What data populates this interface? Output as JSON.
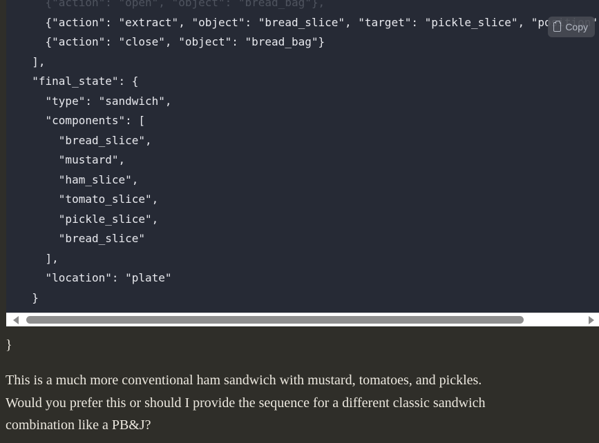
{
  "code": {
    "lines": [
      "    {\"action\": \"open\", \"object\": \"bread_bag\"},",
      "    {\"action\": \"extract\", \"object\": \"bread_slice\", \"target\": \"pickle_slice\", \"position\": \"top\"},",
      "    {\"action\": \"close\", \"object\": \"bread_bag\"}",
      "  ],",
      "  \"final_state\": {",
      "    \"type\": \"sandwich\",",
      "    \"components\": [",
      "      \"bread_slice\",",
      "      \"mustard\",",
      "      \"ham_slice\",",
      "      \"tomato_slice\",",
      "      \"pickle_slice\",",
      "      \"bread_slice\"",
      "    ],",
      "    \"location\": \"plate\"",
      "  }"
    ]
  },
  "copy_button": {
    "label": "Copy",
    "icon": "clipboard-icon"
  },
  "closing_brace": "}",
  "message": {
    "lines": [
      "This is a much more conventional ham sandwich with mustard, tomatoes, and pickles.",
      "Would you prefer this or should I provide the sequence for a different classic sandwich",
      "combination like a PB&J?"
    ]
  },
  "colors": {
    "page_background": "#2f2e29",
    "code_background": "#262a35",
    "text": "#ece8df",
    "code_text": "#e8e9ee",
    "scrollbar_track": "#ffffff",
    "scrollbar_thumb": "#8f8f8f"
  }
}
